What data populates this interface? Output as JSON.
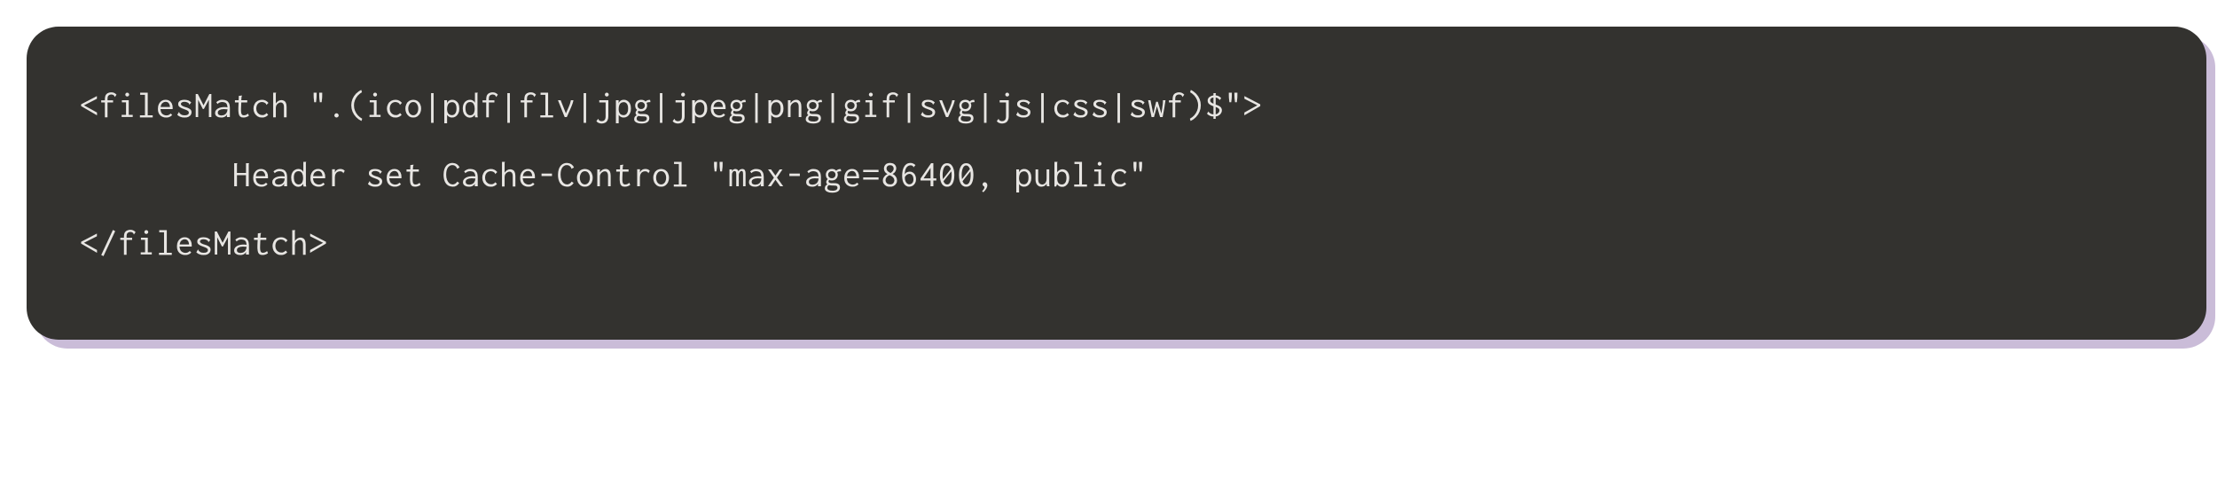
{
  "code": {
    "line1": "<filesMatch \".(ico|pdf|flv|jpg|jpeg|png|gif|svg|js|css|swf)$\">",
    "line2": "        Header set Cache-Control \"max-age=86400, public\"",
    "line3": "</filesMatch>"
  }
}
